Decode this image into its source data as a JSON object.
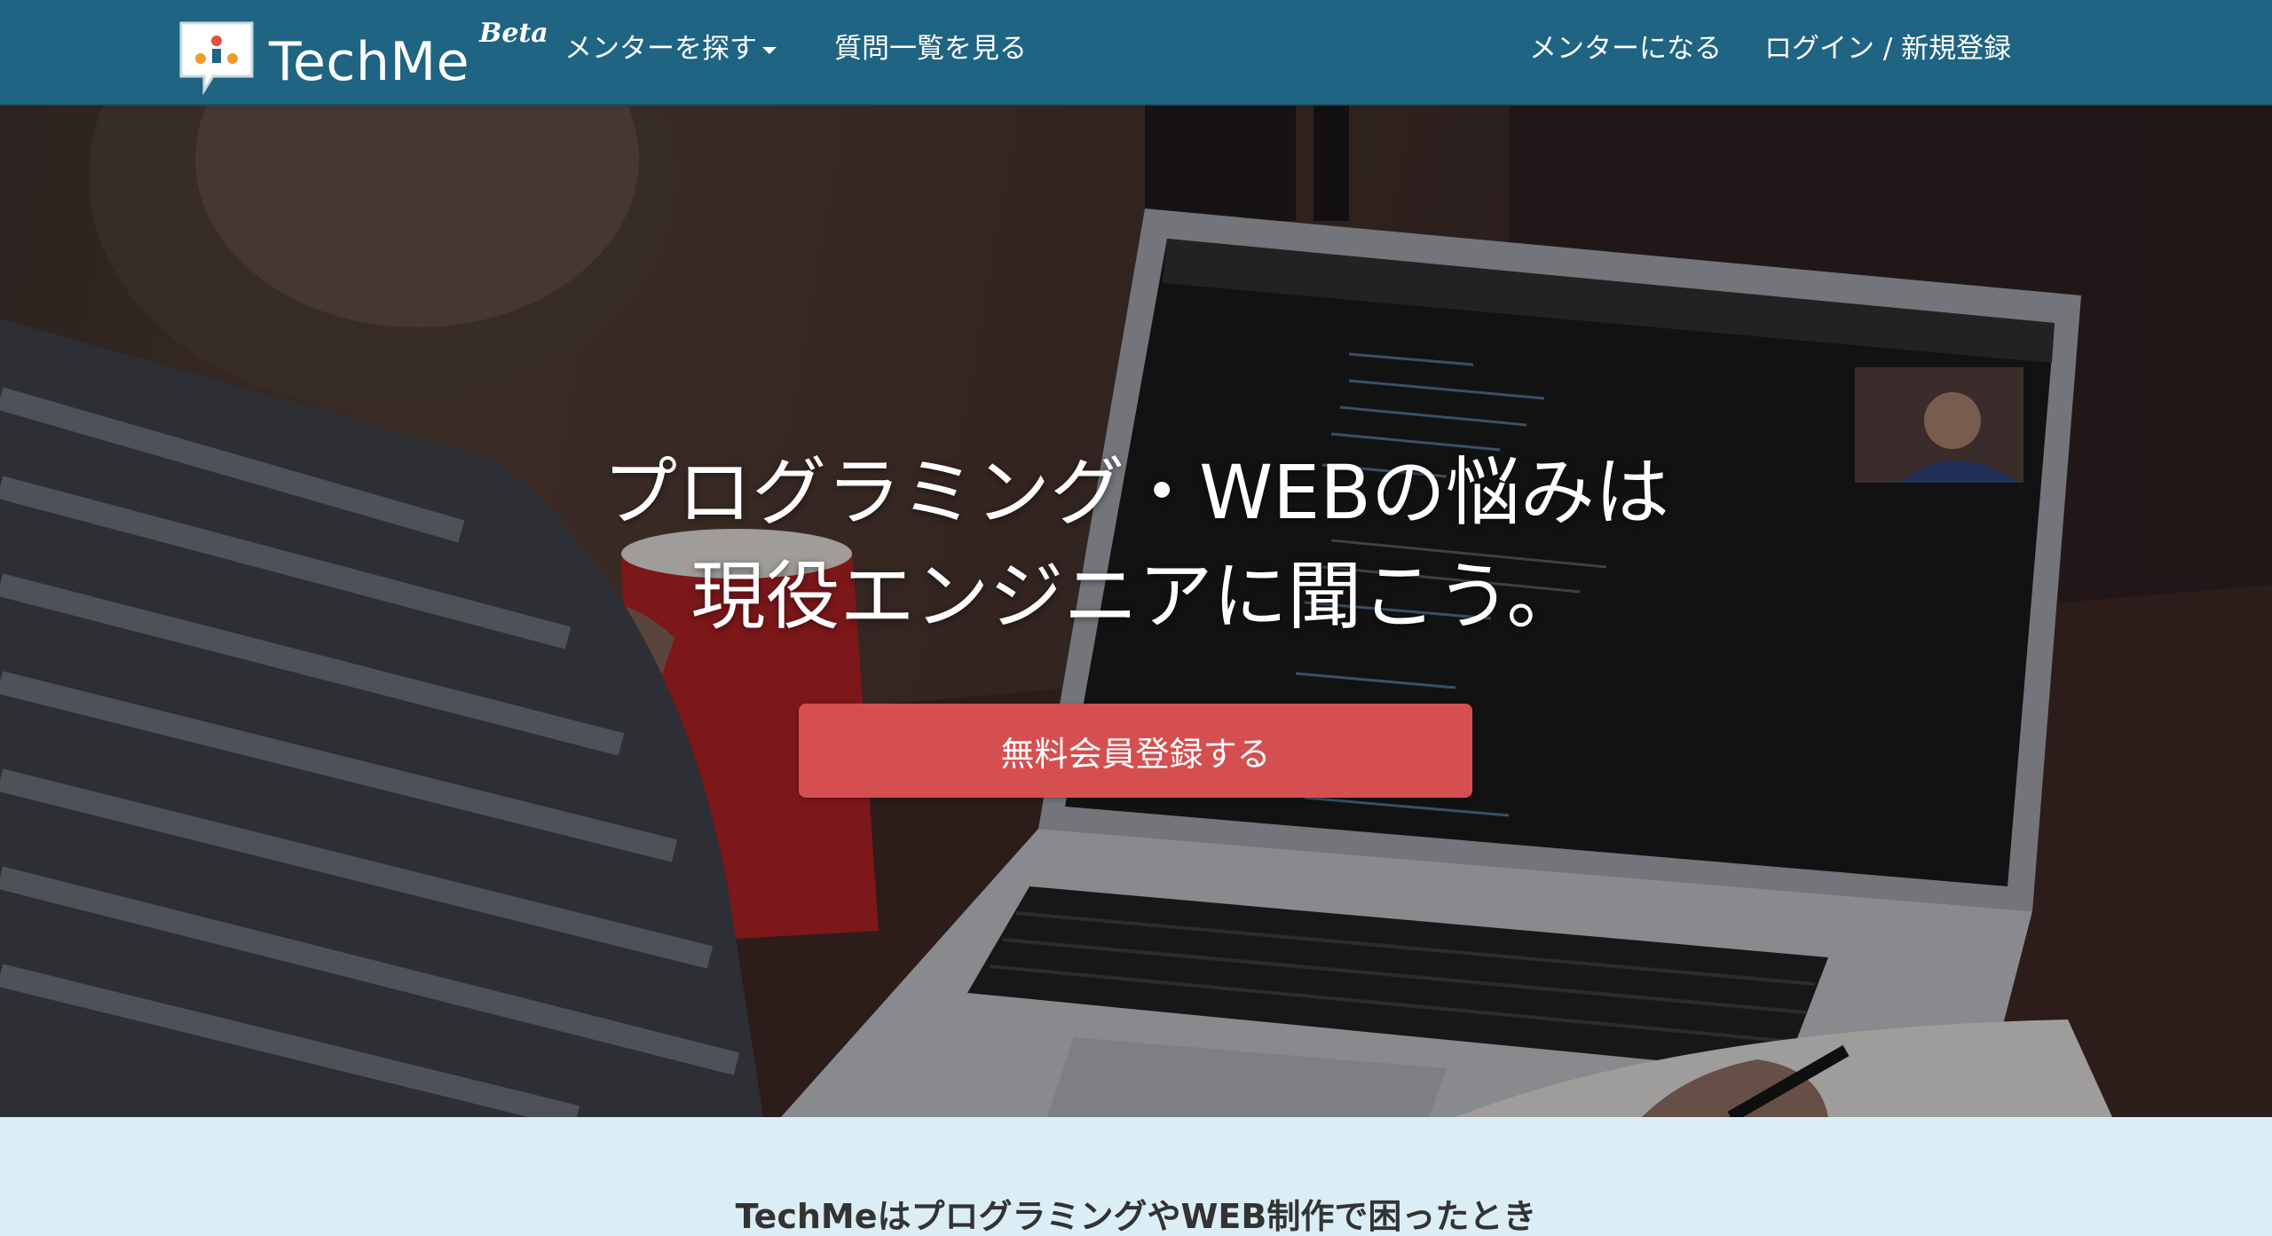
{
  "navbar": {
    "brand": "TechMe",
    "beta": "Beta",
    "find_mentor": "メンターを探す",
    "questions": "質問一覧を見る",
    "become_mentor": "メンターになる",
    "login_signup": "ログイン / 新規登録"
  },
  "hero": {
    "title_line1": "プログラミング・WEBの悩みは",
    "title_line2": "現役エンジニアに聞こう。",
    "cta_label": "無料会員登録する"
  },
  "intro": {
    "text": "TechMeはプログラミングやWEB制作で困ったとき"
  },
  "colors": {
    "navbar": "#1f6483",
    "cta": "#d54f50",
    "section_bg": "#dbeef6"
  },
  "icons": {
    "logo": "speech-bubble-logo-icon",
    "dropdown": "caret-down-icon"
  }
}
